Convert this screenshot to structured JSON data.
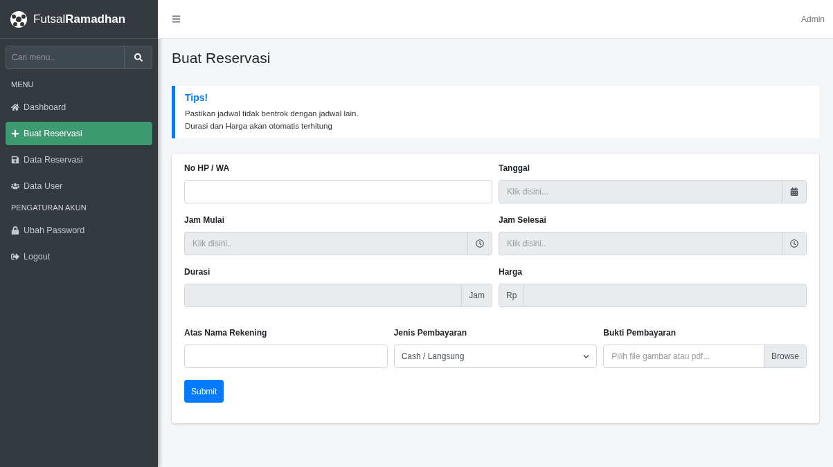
{
  "sidebar": {
    "brand_light": "Futsal",
    "brand_bold": "Ramadhan",
    "search": {
      "placeholder": "Cari menu.."
    },
    "sections": [
      {
        "heading": "MENU",
        "items": [
          {
            "label": "Dashboard",
            "selected": false
          },
          {
            "label": "Buat Reservasi",
            "selected": true
          },
          {
            "label": "Data Reservasi",
            "selected": false
          },
          {
            "label": "Data User",
            "selected": false
          }
        ]
      },
      {
        "heading": "PENGATURAN AKUN",
        "items": [
          {
            "label": "Ubah Password",
            "selected": false
          },
          {
            "label": "Logout",
            "selected": false
          }
        ]
      }
    ]
  },
  "topbar": {
    "user": "Admin"
  },
  "page_title": "Buat Reservasi",
  "callout": {
    "title": "Tips!",
    "lines": [
      "Pastikan jadwal tidak bentrok dengan jadwal lain.",
      "Durasi dan Harga akan otomatis terhitung"
    ]
  },
  "form": {
    "rows": [
      [
        {
          "label": "No HP / WA",
          "kind": "text",
          "disabled": false
        },
        {
          "label": "Tanggal",
          "kind": "picker",
          "placeholder": "Klik disini...",
          "disabled": true
        }
      ],
      [
        {
          "label": "Jam Mulai",
          "kind": "time",
          "placeholder": "Klik disini..",
          "disabled": true
        },
        {
          "label": "Jam Selesai",
          "kind": "time",
          "placeholder": "Klik disini..",
          "disabled": true
        }
      ],
      [
        {
          "label": "Durasi",
          "kind": "suffix",
          "addon": "Jam",
          "disabled": true
        },
        {
          "label": "Harga",
          "kind": "prefix",
          "addon": "Rp",
          "disabled": true
        }
      ],
      [
        {
          "label": "Atas Nama Rekening",
          "kind": "text",
          "disabled": false
        },
        {
          "label": "Jenis Pembayaran",
          "kind": "select",
          "value": "Cash / Langsung",
          "disabled": false
        },
        {
          "label": "Bukti Pembayaran",
          "kind": "file",
          "placeholder": "Pilih file gambar atau pdf...",
          "addon": "Browse",
          "disabled": false
        }
      ]
    ],
    "submit": "Submit"
  }
}
